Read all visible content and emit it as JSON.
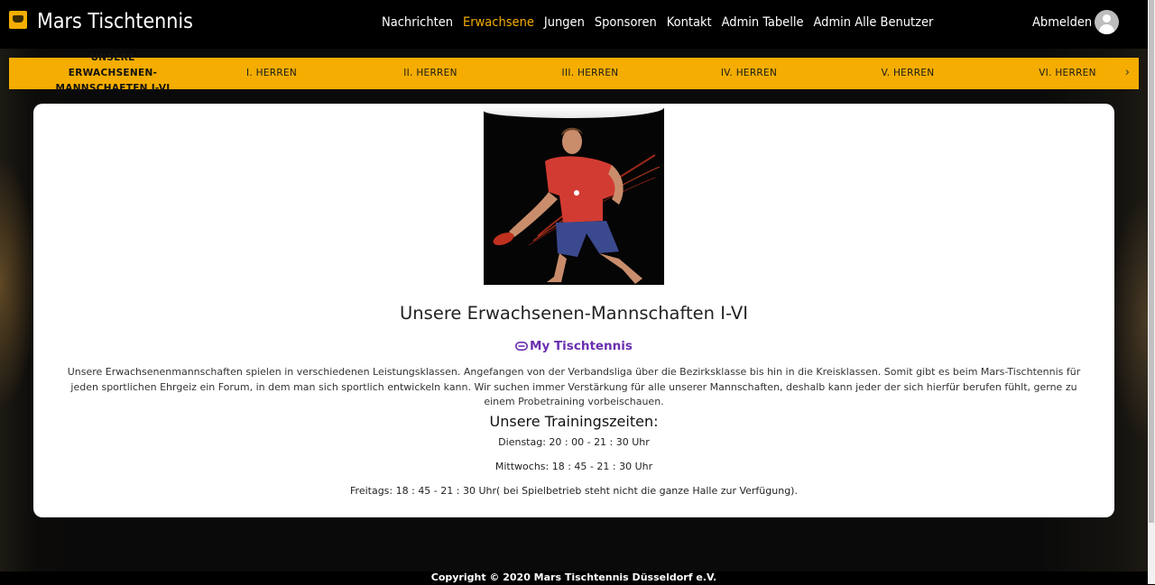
{
  "header": {
    "brand": "Mars Tischtennis",
    "nav": [
      "Nachrichten",
      "Erwachsene",
      "Jungen",
      "Sponsoren",
      "Kontakt",
      "Admin Tabelle",
      "Admin Alle Benutzer"
    ],
    "active_nav": "Erwachsene",
    "logout_label": "Abmelden"
  },
  "team_tabs": {
    "items": [
      "UNSERE ERWACHSENEN-MANNSCHAFTEN I-VI",
      "I. HERREN",
      "II. HERREN",
      "III. HERREN",
      "IV. HERREN",
      "V. HERREN",
      "VI. HERREN"
    ],
    "next_icon": "chevron-right-icon"
  },
  "content": {
    "title": "Unsere Erwachsenen-Mannschaften I-VI",
    "link_label": "My Tischtennis",
    "link_icon": "link-icon",
    "description": "Unsere Erwachsenenmannschaften spielen in verschiedenen Leistungsklassen. Angefangen von der Verbandsliga über die Bezirksklasse bis hin in die Kreisklassen. Somit gibt es beim Mars-Tischtennis für jeden sportlichen Ehrgeiz ein Forum, in dem man sich sportlich entwickeln kann. Wir suchen immer Verstärkung für alle unserer Mannschaften, deshalb kann jeder der sich hierfür berufen fühlt, gerne zu einem Probetraining vorbeischauen.",
    "training_heading": "Unsere Trainingszeiten:",
    "training": [
      "Dienstag: 20 : 00 - 21 : 30 Uhr",
      "Mittwochs: 18 : 45 - 21 : 30 Uhr",
      "Freitags: 18 : 45 - 21 : 30 Uhr( bei Spielbetrieb steht nicht die ganze Halle zur Verfügung)."
    ]
  },
  "footer": {
    "copyright": "Copyright © 2020  Mars Tischtennis Düsseldorf e.V."
  },
  "colors": {
    "accent": "#f4ad00",
    "link": "#6a2fb0"
  }
}
